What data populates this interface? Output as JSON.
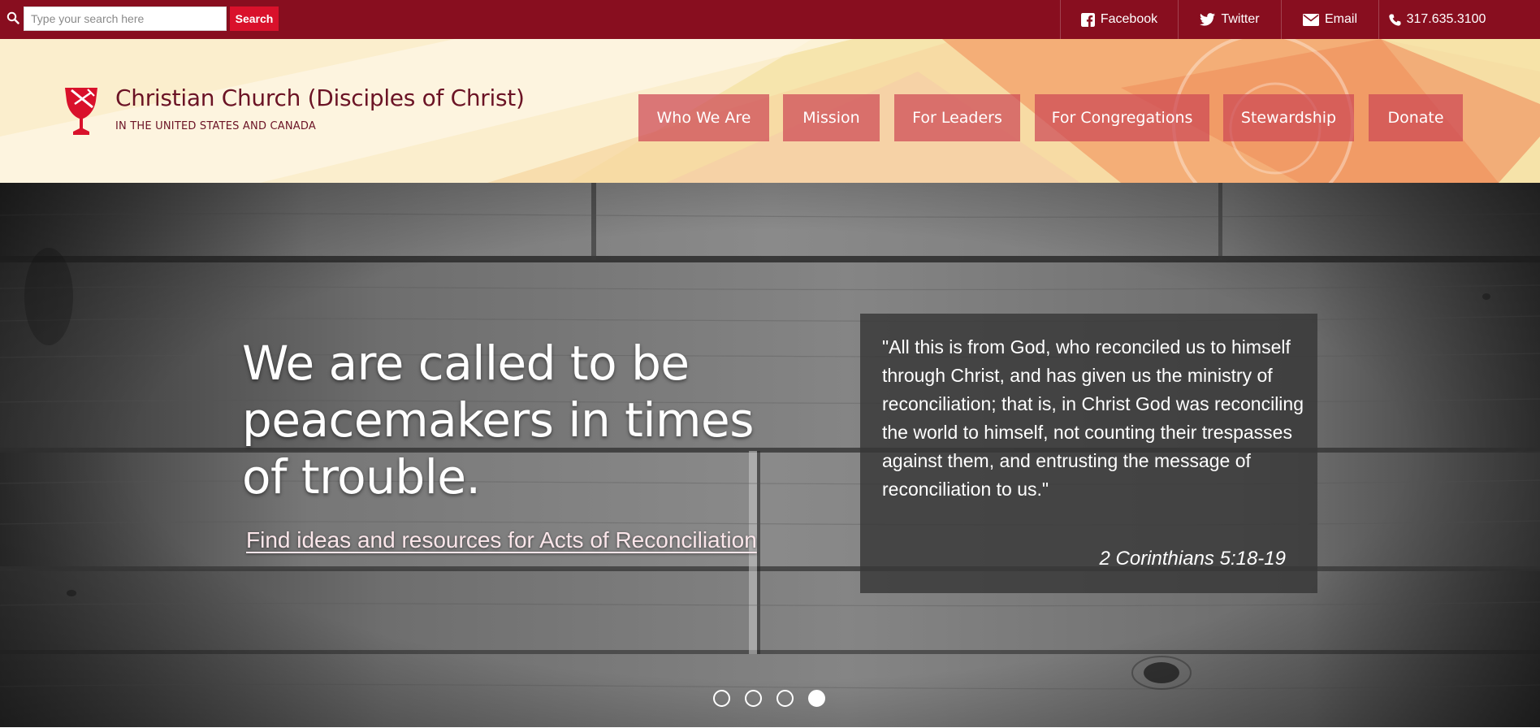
{
  "topbar": {
    "search_placeholder": "Type your search here",
    "search_button": "Search",
    "social": [
      {
        "label": "Facebook",
        "icon": "facebook-icon"
      },
      {
        "label": "Twitter",
        "icon": "twitter-icon"
      },
      {
        "label": "Email",
        "icon": "envelope-icon"
      },
      {
        "label": "317.635.3100",
        "icon": "phone-icon"
      }
    ]
  },
  "header": {
    "org_name": "Christian Church (Disciples of Christ)",
    "org_sub": "IN THE UNITED STATES AND CANADA",
    "nav": [
      "Who We Are",
      "Mission",
      "For Leaders",
      "For Congregations",
      "Stewardship",
      "Donate"
    ]
  },
  "hero": {
    "heading": "We are called to be peacemakers in times of trouble.",
    "link": "Find ideas and resources for Acts of Reconciliation",
    "quote": "\"All this is from God, who reconciled us to himself through Christ, and has given us the ministry of reconciliation; that is, in Christ God was reconciling the world to himself, not counting their trespasses against them, and entrusting the message of reconciliation to us.\"",
    "citation": "2 Corinthians 5:18-19",
    "slides": {
      "count": 4,
      "active": 4
    }
  },
  "colors": {
    "topbar": "#880e1f",
    "search_button": "#d9112b",
    "nav_button": "#cd4854",
    "org_text": "#6b1325"
  }
}
